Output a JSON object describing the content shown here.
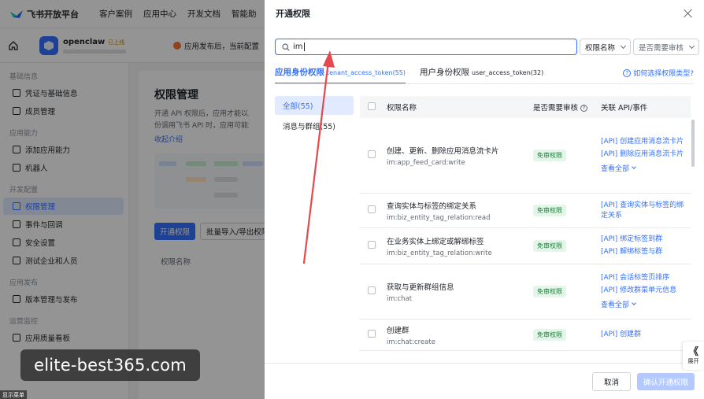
{
  "topnav": {
    "brand": "飞书开放平台",
    "items": [
      "客户案例",
      "应用中心",
      "开发文档",
      "智能助"
    ]
  },
  "appbar": {
    "app_name": "openclaw",
    "app_badge": "已上线",
    "notice": "应用发布后，当前配置"
  },
  "sidebar": {
    "groups": [
      {
        "title": "基础信息",
        "items": [
          "凭证与基础信息",
          "成员管理"
        ]
      },
      {
        "title": "应用能力",
        "items": [
          "添加应用能力",
          "机器人"
        ]
      },
      {
        "title": "开发配置",
        "items": [
          "权限管理",
          "事件与回调",
          "安全设置",
          "测试企业和人员"
        ]
      },
      {
        "title": "应用发布",
        "items": [
          "版本管理与发布"
        ]
      },
      {
        "title": "运营监控",
        "items": [
          "应用质量看板"
        ]
      }
    ],
    "active": "权限管理"
  },
  "main": {
    "title": "权限管理",
    "desc_line1": "开通 API 权限后，应用才能以应用",
    "desc_line2": "份调用飞书 API 时，应用可能还需",
    "collapse_link": "收起介绍",
    "btn_open": "开通权限",
    "btn_batch": "批量导入/导出权限",
    "col_name": "权限名称"
  },
  "drawer": {
    "title": "开通权限",
    "search": {
      "value": "im",
      "placeholder": ""
    },
    "select_name": "权限名称",
    "select_review": "是否需要审核",
    "tabs": [
      {
        "label": "应用身份权限",
        "sub": "tenant_access_token(55)",
        "active": true
      },
      {
        "label": "用户身份权限",
        "sub": "user_access_token(32)",
        "active": false
      }
    ],
    "help_link": "如何选择权限类型?",
    "categories": [
      {
        "label": "全部(55)",
        "active": true
      },
      {
        "label": "消息与群组(55)",
        "active": false
      }
    ],
    "columns": {
      "name": "权限名称",
      "review": "是否需要审核",
      "api": "关联 API/事件"
    },
    "rows": [
      {
        "title": "创建、更新、删除应用消息流卡片",
        "key": "im:app_feed_card:write",
        "badge": "免审权限",
        "apis": [
          "[API] 创建应用消息流卡片",
          "[API] 删除应用消息流卡片"
        ],
        "more": "查看全部"
      },
      {
        "title": "查询实体与标签的绑定关系",
        "key": "im:biz_entity_tag_relation:read",
        "badge": "免审权限",
        "apis": [
          "[API] 查询实体与标签的绑定关系"
        ]
      },
      {
        "title": "在业务实体上绑定或解绑标签",
        "key": "im:biz_entity_tag_relation:write",
        "badge": "免审权限",
        "apis": [
          "[API] 绑定标签到群",
          "[API] 解绑标签与群"
        ]
      },
      {
        "title": "获取与更新群组信息",
        "key": "im:chat",
        "badge": "免审权限",
        "apis": [
          "[API] 会话标签页排序",
          "[API] 修改群菜单元信息"
        ],
        "more": "查看全部"
      },
      {
        "title": "创建群",
        "key": "im:chat:create",
        "badge": "免审权限",
        "apis": [
          "[API] 创建群"
        ]
      }
    ],
    "footer": {
      "cancel": "取消",
      "confirm": "确认开通权限"
    }
  },
  "expand_tab": {
    "arrow": "《",
    "label": "展开"
  },
  "watermark": "elite-best365.com",
  "status_tag": "显示菜单",
  "colors": {
    "accent": "#3370ff",
    "badge_bg": "#e4f5ea",
    "badge_text": "#1a7f37",
    "arrow": "#e5484d"
  }
}
